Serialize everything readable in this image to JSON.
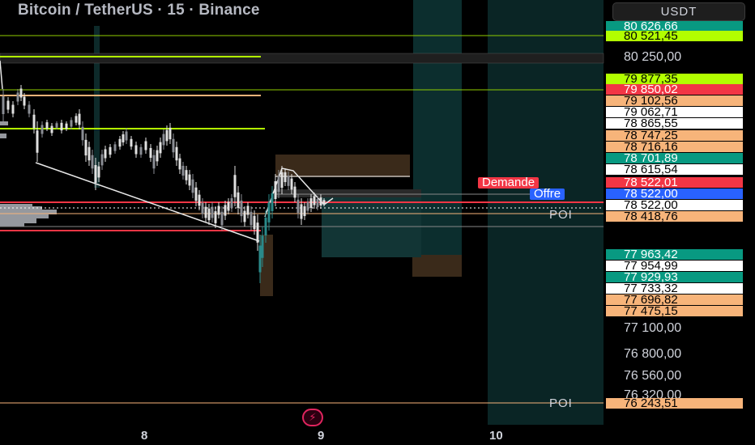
{
  "header": {
    "title": "Bitcoin / TetherUS · 15 · Binance",
    "currency_button": "USDT"
  },
  "price_tags": [
    {
      "text": "80 626,66",
      "bg": "#089981",
      "fg": "#ffffff"
    },
    {
      "text": "80 521,45",
      "bg": "#b2ff00",
      "fg": "#000000"
    },
    {
      "text": "79 877,35",
      "bg": "#b2ff00",
      "fg": "#000000"
    },
    {
      "text": "79 850,02",
      "bg": "#f23645",
      "fg": "#ffffff"
    },
    {
      "text": "79 102,56",
      "bg": "#f7b47a",
      "fg": "#000000"
    },
    {
      "text": "79 062,71",
      "bg": "#ffffff",
      "fg": "#000000"
    },
    {
      "text": "78 865,55",
      "bg": "#ffffff",
      "fg": "#000000"
    },
    {
      "text": "78 747,25",
      "bg": "#f7b47a",
      "fg": "#000000"
    },
    {
      "text": "78 716,16",
      "bg": "#f7b47a",
      "fg": "#000000"
    },
    {
      "text": "78 701,89",
      "bg": "#089981",
      "fg": "#ffffff"
    },
    {
      "text": "78 615,54",
      "bg": "#ffffff",
      "fg": "#000000"
    },
    {
      "text": "78 522,01",
      "bg": "#f23645",
      "fg": "#ffffff"
    },
    {
      "text": "78 522,00",
      "bg": "#2962ff",
      "fg": "#ffffff"
    },
    {
      "text": "78 522,00",
      "bg": "#ffffff",
      "fg": "#000000"
    },
    {
      "text": "78 418,76",
      "bg": "#f7b47a",
      "fg": "#000000"
    },
    {
      "text": "77 963,42",
      "bg": "#089981",
      "fg": "#ffffff"
    },
    {
      "text": "77 954,99",
      "bg": "#ffffff",
      "fg": "#000000"
    },
    {
      "text": "77 929,93",
      "bg": "#089981",
      "fg": "#ffffff"
    },
    {
      "text": "77 733,32",
      "bg": "#ffffff",
      "fg": "#000000"
    },
    {
      "text": "77 696,82",
      "bg": "#f7b47a",
      "fg": "#000000"
    },
    {
      "text": "77 475,15",
      "bg": "#f7b47a",
      "fg": "#000000"
    },
    {
      "text": "76 243,51",
      "bg": "#f7b47a",
      "fg": "#000000"
    }
  ],
  "axis_prices": [
    "80 250,00",
    "77 100,00",
    "76 800,00",
    "76 560,00",
    "76 320,00"
  ],
  "side_labels": {
    "demand": "Demande",
    "offer": "Offre"
  },
  "poi_labels": [
    "POI",
    "POI"
  ],
  "x_axis": [
    "8",
    "9",
    "10"
  ],
  "colors": {
    "lime": "#b2ff00",
    "red": "#f23645",
    "orange": "#f7b47a",
    "teal": "#089981",
    "blue": "#2962ff"
  },
  "icons": {
    "flash": "lightning-bolt-icon"
  }
}
